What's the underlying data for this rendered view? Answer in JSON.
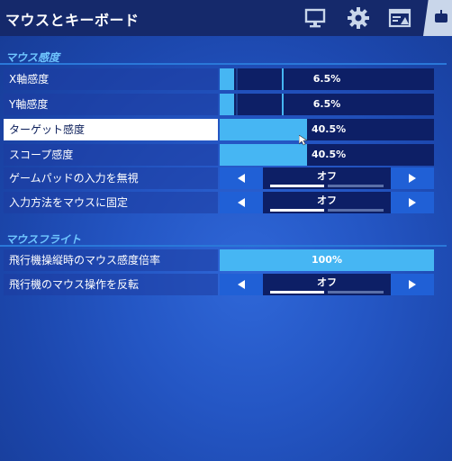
{
  "header": {
    "title": "マウスとキーボード",
    "tabs": [
      {
        "icon": "monitor-icon"
      },
      {
        "icon": "gear-icon"
      },
      {
        "icon": "display-settings-icon"
      },
      {
        "icon": "keyboard-mouse-icon",
        "active": true
      }
    ]
  },
  "sections": {
    "mouse_sensitivity": "マウス感度",
    "mouse_flight": "マウスフライト"
  },
  "rows": {
    "x_sens": {
      "label": "X軸感度",
      "value": "6.5%",
      "percent": 6.5
    },
    "y_sens": {
      "label": "Y軸感度",
      "value": "6.5%",
      "percent": 6.5
    },
    "target_sens": {
      "label": "ターゲット感度",
      "value": "40.5%",
      "percent": 40.5
    },
    "scope_sens": {
      "label": "スコープ感度",
      "value": "40.5%",
      "percent": 40.5
    },
    "ignore_gamepad": {
      "label": "ゲームパッドの入力を無視",
      "value": "オフ"
    },
    "lock_input": {
      "label": "入力方法をマウスに固定",
      "value": "オフ"
    },
    "flight_sens_mult": {
      "label": "飛行機操縦時のマウス感度倍率",
      "value": "100%",
      "percent": 100
    },
    "invert_flight": {
      "label": "飛行機のマウス操作を反転",
      "value": "オフ"
    }
  },
  "colors": {
    "accent": "#46b6f3",
    "panel": "#0d1f66",
    "button": "#2060d6"
  }
}
